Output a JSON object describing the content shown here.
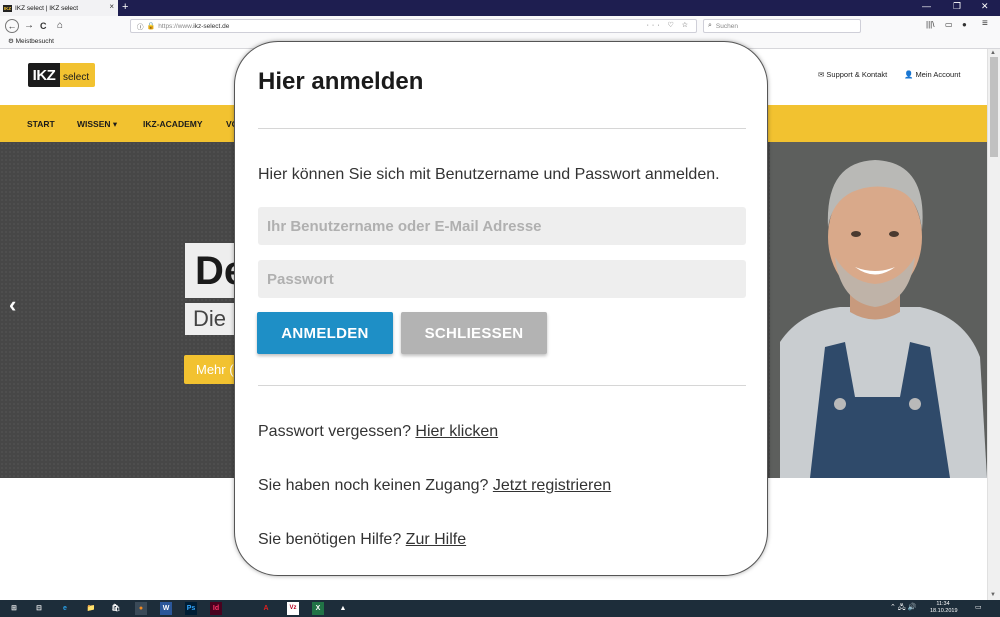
{
  "browser": {
    "tab_favicon": "IKZ",
    "tab_title": "IKZ select | IKZ select",
    "tab_close": "×",
    "new_tab": "+",
    "window_controls": [
      "—",
      "❐",
      "✕"
    ],
    "nav_back": "←",
    "nav_forward": "→",
    "nav_reload": "C",
    "nav_home": "⌂",
    "url_scheme": "https://www.",
    "url_host": "ikz-select.de",
    "url_actions": "··· ♡ ☆",
    "search_placeholder": "Suchen",
    "toolbar_library": "|||\\",
    "toolbar_sidebar": "▭",
    "toolbar_account": "●",
    "toolbar_menu": "≡",
    "bookmark": "Meistbesucht"
  },
  "site": {
    "logo_left": "IKZ",
    "logo_right": "select",
    "support_link": "Support & Kontakt",
    "account_link": "Mein Account",
    "nav": [
      "START",
      "WISSEN",
      "IKZ-ACADEMY",
      "VO"
    ],
    "hero_headline": "De",
    "hero_subline": "Die I",
    "hero_button": "Mehr (",
    "hero_prev": "‹",
    "hero_next": "›"
  },
  "modal": {
    "title": "Hier anmelden",
    "intro": "Hier können Sie sich mit Benutzername und Passwort anmelden.",
    "username_placeholder": "Ihr Benutzername oder E-Mail Adresse",
    "password_placeholder": "Passwort",
    "login_button": "ANMELDEN",
    "close_button": "SCHLIESSEN",
    "forgot_text": "Passwort vergessen?",
    "forgot_link": "Hier klicken",
    "register_text": "Sie haben noch keinen Zugang?",
    "register_link": "Jetzt registrieren",
    "help_text": "Sie benötigen Hilfe?",
    "help_link": "Zur Hilfe"
  },
  "taskbar": {
    "time": "11:34",
    "date": "18.10.2019",
    "apps": [
      "⊞",
      "⊟",
      "e",
      "📁",
      "🛍",
      "●",
      "W",
      "Ps",
      "Id",
      "A",
      "Vz",
      "X",
      "▲"
    ],
    "tray": "⌃ 🖧 🔊"
  },
  "colors": {
    "brand_yellow": "#f2c230",
    "login_blue": "#1e8fc6",
    "close_gray": "#b3b3b3",
    "tabstrip_navy": "#1e1e50"
  }
}
